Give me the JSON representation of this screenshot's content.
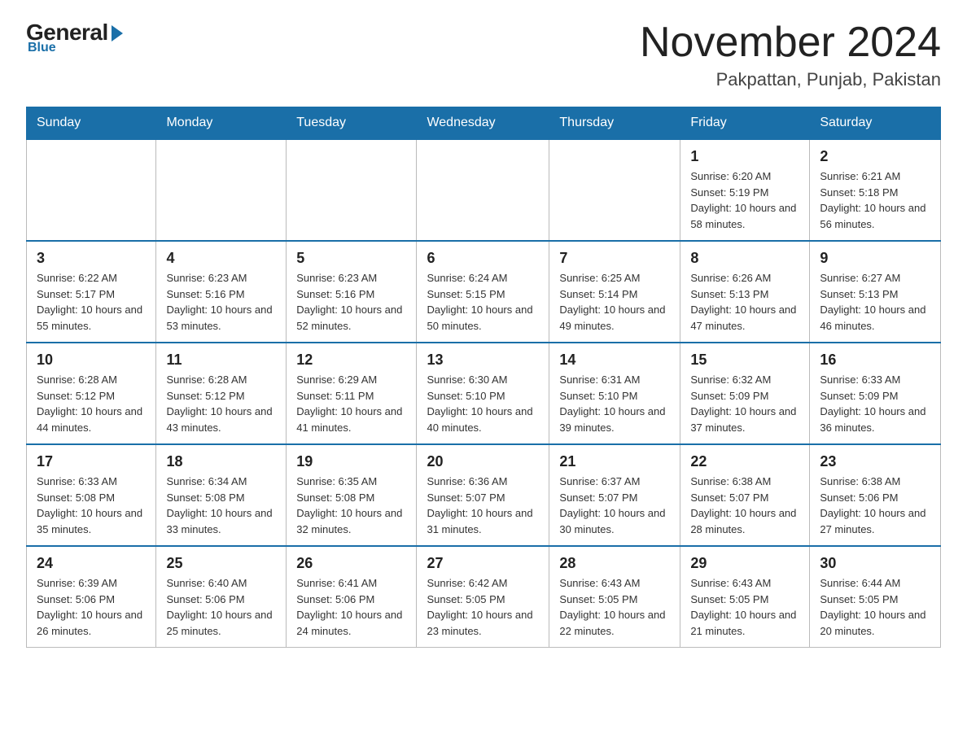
{
  "header": {
    "logo_general": "General",
    "logo_blue": "Blue",
    "month_year": "November 2024",
    "location": "Pakpattan, Punjab, Pakistan"
  },
  "days_of_week": [
    "Sunday",
    "Monday",
    "Tuesday",
    "Wednesday",
    "Thursday",
    "Friday",
    "Saturday"
  ],
  "weeks": [
    [
      {
        "day": "",
        "info": ""
      },
      {
        "day": "",
        "info": ""
      },
      {
        "day": "",
        "info": ""
      },
      {
        "day": "",
        "info": ""
      },
      {
        "day": "",
        "info": ""
      },
      {
        "day": "1",
        "info": "Sunrise: 6:20 AM\nSunset: 5:19 PM\nDaylight: 10 hours and 58 minutes."
      },
      {
        "day": "2",
        "info": "Sunrise: 6:21 AM\nSunset: 5:18 PM\nDaylight: 10 hours and 56 minutes."
      }
    ],
    [
      {
        "day": "3",
        "info": "Sunrise: 6:22 AM\nSunset: 5:17 PM\nDaylight: 10 hours and 55 minutes."
      },
      {
        "day": "4",
        "info": "Sunrise: 6:23 AM\nSunset: 5:16 PM\nDaylight: 10 hours and 53 minutes."
      },
      {
        "day": "5",
        "info": "Sunrise: 6:23 AM\nSunset: 5:16 PM\nDaylight: 10 hours and 52 minutes."
      },
      {
        "day": "6",
        "info": "Sunrise: 6:24 AM\nSunset: 5:15 PM\nDaylight: 10 hours and 50 minutes."
      },
      {
        "day": "7",
        "info": "Sunrise: 6:25 AM\nSunset: 5:14 PM\nDaylight: 10 hours and 49 minutes."
      },
      {
        "day": "8",
        "info": "Sunrise: 6:26 AM\nSunset: 5:13 PM\nDaylight: 10 hours and 47 minutes."
      },
      {
        "day": "9",
        "info": "Sunrise: 6:27 AM\nSunset: 5:13 PM\nDaylight: 10 hours and 46 minutes."
      }
    ],
    [
      {
        "day": "10",
        "info": "Sunrise: 6:28 AM\nSunset: 5:12 PM\nDaylight: 10 hours and 44 minutes."
      },
      {
        "day": "11",
        "info": "Sunrise: 6:28 AM\nSunset: 5:12 PM\nDaylight: 10 hours and 43 minutes."
      },
      {
        "day": "12",
        "info": "Sunrise: 6:29 AM\nSunset: 5:11 PM\nDaylight: 10 hours and 41 minutes."
      },
      {
        "day": "13",
        "info": "Sunrise: 6:30 AM\nSunset: 5:10 PM\nDaylight: 10 hours and 40 minutes."
      },
      {
        "day": "14",
        "info": "Sunrise: 6:31 AM\nSunset: 5:10 PM\nDaylight: 10 hours and 39 minutes."
      },
      {
        "day": "15",
        "info": "Sunrise: 6:32 AM\nSunset: 5:09 PM\nDaylight: 10 hours and 37 minutes."
      },
      {
        "day": "16",
        "info": "Sunrise: 6:33 AM\nSunset: 5:09 PM\nDaylight: 10 hours and 36 minutes."
      }
    ],
    [
      {
        "day": "17",
        "info": "Sunrise: 6:33 AM\nSunset: 5:08 PM\nDaylight: 10 hours and 35 minutes."
      },
      {
        "day": "18",
        "info": "Sunrise: 6:34 AM\nSunset: 5:08 PM\nDaylight: 10 hours and 33 minutes."
      },
      {
        "day": "19",
        "info": "Sunrise: 6:35 AM\nSunset: 5:08 PM\nDaylight: 10 hours and 32 minutes."
      },
      {
        "day": "20",
        "info": "Sunrise: 6:36 AM\nSunset: 5:07 PM\nDaylight: 10 hours and 31 minutes."
      },
      {
        "day": "21",
        "info": "Sunrise: 6:37 AM\nSunset: 5:07 PM\nDaylight: 10 hours and 30 minutes."
      },
      {
        "day": "22",
        "info": "Sunrise: 6:38 AM\nSunset: 5:07 PM\nDaylight: 10 hours and 28 minutes."
      },
      {
        "day": "23",
        "info": "Sunrise: 6:38 AM\nSunset: 5:06 PM\nDaylight: 10 hours and 27 minutes."
      }
    ],
    [
      {
        "day": "24",
        "info": "Sunrise: 6:39 AM\nSunset: 5:06 PM\nDaylight: 10 hours and 26 minutes."
      },
      {
        "day": "25",
        "info": "Sunrise: 6:40 AM\nSunset: 5:06 PM\nDaylight: 10 hours and 25 minutes."
      },
      {
        "day": "26",
        "info": "Sunrise: 6:41 AM\nSunset: 5:06 PM\nDaylight: 10 hours and 24 minutes."
      },
      {
        "day": "27",
        "info": "Sunrise: 6:42 AM\nSunset: 5:05 PM\nDaylight: 10 hours and 23 minutes."
      },
      {
        "day": "28",
        "info": "Sunrise: 6:43 AM\nSunset: 5:05 PM\nDaylight: 10 hours and 22 minutes."
      },
      {
        "day": "29",
        "info": "Sunrise: 6:43 AM\nSunset: 5:05 PM\nDaylight: 10 hours and 21 minutes."
      },
      {
        "day": "30",
        "info": "Sunrise: 6:44 AM\nSunset: 5:05 PM\nDaylight: 10 hours and 20 minutes."
      }
    ]
  ]
}
